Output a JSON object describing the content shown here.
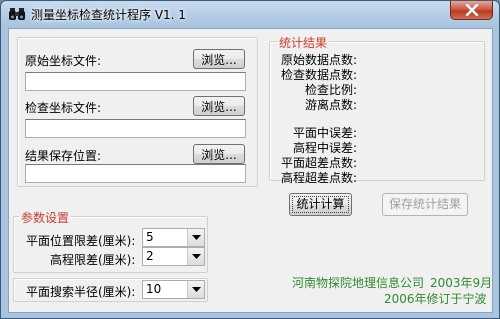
{
  "window": {
    "title": "测量坐标检查统计程序 V1. 1"
  },
  "files": {
    "original_label": "原始坐标文件:",
    "original_value": "",
    "check_label": "检查坐标文件:",
    "check_value": "",
    "save_label": "结果保存位置:",
    "save_value": "",
    "browse_label": "浏览..."
  },
  "results": {
    "legend": "统计结果",
    "rows": [
      "原始数据点数:",
      "检查数据点数:",
      "检查比例:",
      "游离点数:",
      "平面中误差:",
      "高程中误差:",
      "平面超差点数:",
      "高程超差点数:"
    ]
  },
  "actions": {
    "compute_label": "统计计算",
    "save_label": "保存统计结果"
  },
  "params": {
    "legend": "参数设置",
    "plane_tol_label": "平面位置限差(厘米):",
    "plane_tol_value": "5",
    "height_tol_label": "高程限差(厘米):",
    "height_tol_value": "2",
    "search_radius_label": "平面搜索半径(厘米):",
    "search_radius_value": "10"
  },
  "footer": {
    "org": "河南物探院地理信息公司",
    "year": "2003年9月",
    "revision": "2006年修订于宁波"
  }
}
